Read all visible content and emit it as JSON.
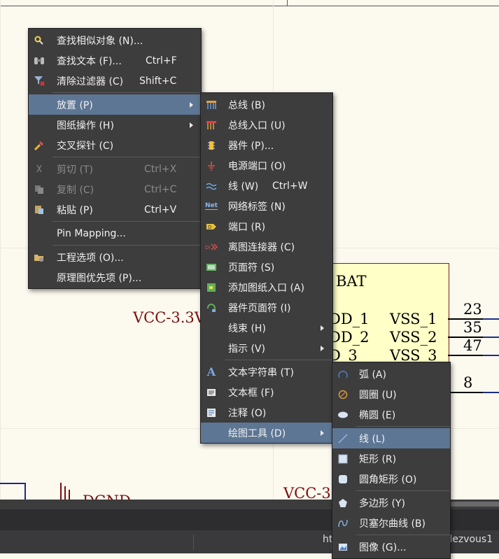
{
  "schematic": {
    "net_labels": [
      "VCC-3.3V",
      "VCC-3",
      "DGND"
    ],
    "component": {
      "name": "BAT",
      "left_pins": [
        "DD_1",
        "DD_2",
        "D_3"
      ],
      "right_pins": [
        "VSS_1",
        "VSS_2",
        "VSS_3"
      ],
      "pin_numbers": [
        "23",
        "35",
        "47",
        "8"
      ]
    }
  },
  "watermark": "https://blog.csdn.net/Rendezvous1",
  "context_menu": {
    "items": [
      {
        "label": "查找相似对象 (N)...",
        "icon": "find-similar-icon"
      },
      {
        "label": "查找文本 (F)...",
        "shortcut": "Ctrl+F",
        "icon": "binoculars-icon"
      },
      {
        "label": "清除过滤器 (C)",
        "shortcut": "Shift+C",
        "icon": "clear-filter-icon"
      },
      {
        "label": "放置 (P)",
        "submenu": true,
        "highlighted": true
      },
      {
        "label": "图纸操作 (H)",
        "submenu": true
      },
      {
        "label": "交叉探针 (C)",
        "icon": "cross-probe-icon"
      },
      {
        "label": "剪切 (T)",
        "shortcut": "Ctrl+X",
        "disabled": true,
        "icon": "scissors-icon"
      },
      {
        "label": "复制 (C)",
        "shortcut": "Ctrl+C",
        "disabled": true,
        "icon": "copy-icon"
      },
      {
        "label": "粘贴 (P)",
        "shortcut": "Ctrl+V",
        "icon": "paste-icon"
      },
      {
        "label": "Pin Mapping..."
      },
      {
        "label": "工程选项 (O)...",
        "icon": "project-options-icon"
      },
      {
        "label": "原理图优先项 (P)..."
      }
    ]
  },
  "place_menu": {
    "items": [
      {
        "label": "总线 (B)",
        "icon": "bus-icon"
      },
      {
        "label": "总线入口 (U)",
        "icon": "bus-entry-icon"
      },
      {
        "label": "器件 (P)...",
        "icon": "part-icon"
      },
      {
        "label": "电源端口 (O)",
        "icon": "power-port-icon"
      },
      {
        "label": "线 (W)",
        "shortcut": "Ctrl+W",
        "icon": "wire-icon"
      },
      {
        "label": "网络标签 (N)",
        "icon": "net-label-icon",
        "icon_text": "Net"
      },
      {
        "label": "端口 (R)",
        "icon": "port-icon"
      },
      {
        "label": "离图连接器 (C)",
        "icon": "off-sheet-connector-icon"
      },
      {
        "label": "页面符 (S)",
        "icon": "sheet-symbol-icon"
      },
      {
        "label": "添加图纸入口 (A)",
        "icon": "sheet-entry-icon"
      },
      {
        "label": "器件页面符 (I)",
        "icon": "device-sheet-symbol-icon"
      },
      {
        "label": "线束 (H)",
        "submenu": true
      },
      {
        "label": "指示 (V)",
        "submenu": true
      },
      {
        "label": "文本字符串 (T)",
        "icon": "text-string-icon",
        "icon_text": "A"
      },
      {
        "label": "文本框 (F)",
        "icon": "text-frame-icon"
      },
      {
        "label": "注释 (O)",
        "icon": "note-icon"
      },
      {
        "label": "绘图工具 (D)",
        "submenu": true,
        "highlighted": true
      }
    ]
  },
  "drawing_menu": {
    "items": [
      {
        "label": "弧 (A)",
        "icon": "arc-icon"
      },
      {
        "label": "圆圈 (U)",
        "icon": "circle-icon"
      },
      {
        "label": "椭圆 (E)",
        "icon": "ellipse-icon"
      },
      {
        "label": "线 (L)",
        "icon": "line-icon",
        "highlighted": true
      },
      {
        "label": "矩形 (R)",
        "icon": "rectangle-icon"
      },
      {
        "label": "圆角矩形 (O)",
        "icon": "round-rectangle-icon"
      },
      {
        "label": "多边形 (Y)",
        "icon": "polygon-icon"
      },
      {
        "label": "贝塞尔曲线 (B)",
        "icon": "bezier-icon"
      },
      {
        "label": "图像 (G)...",
        "icon": "image-icon"
      }
    ]
  },
  "colors": {
    "menu_bg": "#3d3d3d",
    "highlight": "#5d7694",
    "schematic_text": "#7a0e0e",
    "component_fill": "#ffffc8"
  }
}
